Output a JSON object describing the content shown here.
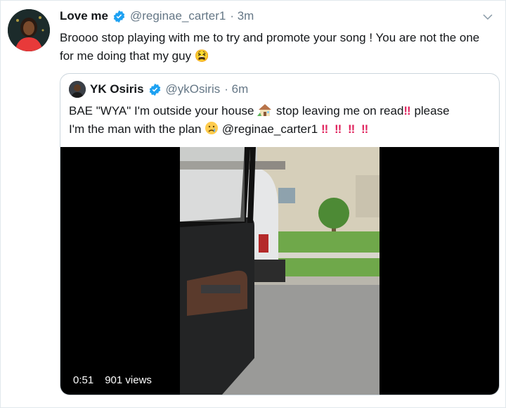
{
  "tweet": {
    "name": "Love me",
    "handle": "@reginae_carter1",
    "time": "· 3m",
    "text": "Broooo stop playing with me to try and promote your song ! You are not the one for me doing that my guy",
    "emoji": "😫"
  },
  "quoted": {
    "name": "YK Osiris",
    "handle": "@ykOsiris",
    "time": "· 6m",
    "line1_part1": "BAE \"WYA\" I'm outside your house",
    "line1_part2": "stop leaving me on read",
    "line1_part3": "please",
    "line2_part1": "I'm the man with the plan",
    "line2_mention": "@reginae_carter1",
    "bangs": "‼ ‼ ‼ ‼",
    "bang_single": "‼"
  },
  "video": {
    "duration": "0:51",
    "views": "901 views"
  },
  "colors": {
    "verified": "#1da1f2",
    "bang": "#e0245e",
    "handle": "#657786"
  }
}
